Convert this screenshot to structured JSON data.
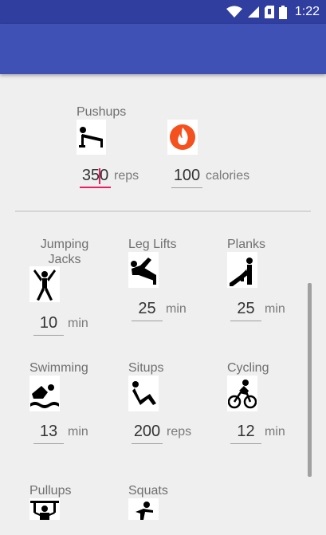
{
  "status_bar": {
    "time": "1:22",
    "icons": [
      "wifi-icon",
      "signal-icon",
      "sim-icon",
      "battery-icon"
    ]
  },
  "colors": {
    "primary": "#3f51b5",
    "primary_dark": "#303f9f",
    "accent": "#e91e63",
    "background": "#efefef"
  },
  "featured": {
    "exercise": "Pushups",
    "icon": "pushup-icon",
    "value": "350",
    "value_before_caret": "35",
    "value_after_caret": "0",
    "unit": "reps",
    "calories_icon": "flame-icon",
    "calories_value": "100",
    "calories_unit": "calories"
  },
  "exercises": [
    {
      "name": "Jumping Jacks",
      "icon": "jumping-jacks-icon",
      "value": "10",
      "unit": "min"
    },
    {
      "name": "Leg Lifts",
      "icon": "leg-lifts-icon",
      "value": "25",
      "unit": "min"
    },
    {
      "name": "Planks",
      "icon": "planks-icon",
      "value": "25",
      "unit": "min"
    },
    {
      "name": "Swimming",
      "icon": "swimming-icon",
      "value": "13",
      "unit": "min"
    },
    {
      "name": "Situps",
      "icon": "situps-icon",
      "value": "200",
      "unit": "reps"
    },
    {
      "name": "Cycling",
      "icon": "cycling-icon",
      "value": "12",
      "unit": "min"
    },
    {
      "name": "Pullups",
      "icon": "pullups-icon"
    },
    {
      "name": "Squats",
      "icon": "squats-icon"
    }
  ]
}
